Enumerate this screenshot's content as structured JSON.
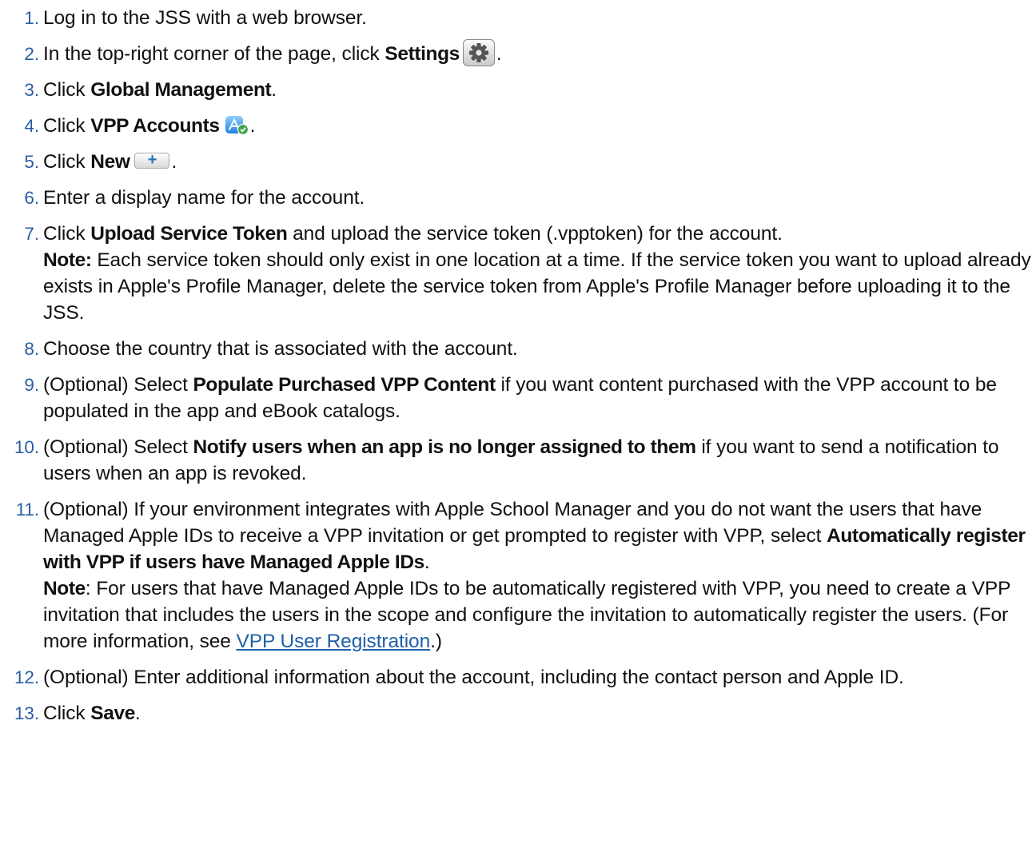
{
  "steps": [
    {
      "num": "1.",
      "parts": [
        {
          "t": "Log in to the JSS with a web browser."
        }
      ]
    },
    {
      "num": "2.",
      "parts": [
        {
          "t": "In the top-right corner of the page, click "
        },
        {
          "b": "Settings"
        },
        {
          "icon": "gear-icon"
        },
        {
          "t": "."
        }
      ]
    },
    {
      "num": "3.",
      "parts": [
        {
          "t": "Click "
        },
        {
          "b": "Global Management"
        },
        {
          "t": "."
        }
      ]
    },
    {
      "num": "4.",
      "parts": [
        {
          "t": "Click "
        },
        {
          "b": "VPP Accounts"
        },
        {
          "icon": "vpp-accounts-icon"
        },
        {
          "t": "."
        }
      ]
    },
    {
      "num": "5.",
      "parts": [
        {
          "t": "Click "
        },
        {
          "b": "New"
        },
        {
          "icon": "plus-icon"
        },
        {
          "t": "."
        }
      ]
    },
    {
      "num": "6.",
      "parts": [
        {
          "t": "Enter a display name for the account."
        }
      ]
    },
    {
      "num": "7.",
      "parts": [
        {
          "t": "Click "
        },
        {
          "b": "Upload Service Token"
        },
        {
          "t": " and upload the service token (.vpptoken) for the account."
        },
        {
          "br": true
        },
        {
          "b": "Note:"
        },
        {
          "t": " Each service token should only exist in one location at a time. If the service token you want to upload already exists in Apple's Profile Manager, delete the service token from Apple's Profile Manager before uploading it to the JSS."
        }
      ]
    },
    {
      "num": "8.",
      "parts": [
        {
          "t": "Choose the country that is associated with the account."
        }
      ]
    },
    {
      "num": "9.",
      "parts": [
        {
          "t": "(Optional) Select "
        },
        {
          "b": "Populate Purchased VPP Content"
        },
        {
          "t": " if you want content purchased with the VPP account to be populated in the app and eBook catalogs."
        }
      ]
    },
    {
      "num": "10.",
      "parts": [
        {
          "t": "(Optional) Select "
        },
        {
          "b": "Notify users when an app is no longer assigned to them"
        },
        {
          "t": " if you want to send a notification to users when an app is revoked."
        }
      ]
    },
    {
      "num": "11.",
      "parts": [
        {
          "t": "(Optional) If your environment integrates with Apple School Manager and you do not want the users that have Managed Apple IDs to receive a VPP invitation or get prompted to register with VPP, select "
        },
        {
          "b": "Automatically register with VPP if users have Managed Apple IDs"
        },
        {
          "t": "."
        },
        {
          "br": true
        },
        {
          "b": "Note"
        },
        {
          "t": ": For users that have Managed Apple IDs to be automatically registered with VPP, you need to create a VPP invitation that includes the users in the scope and configure the invitation to automatically register the users. (For more information, see "
        },
        {
          "link": "VPP User Registration"
        },
        {
          "t": ".)"
        }
      ]
    },
    {
      "num": "12.",
      "parts": [
        {
          "t": "(Optional) Enter additional information about the account, including the contact person and Apple ID."
        }
      ]
    },
    {
      "num": "13.",
      "parts": [
        {
          "t": "Click "
        },
        {
          "b": "Save"
        },
        {
          "t": "."
        }
      ]
    }
  ],
  "colors": {
    "step_number": "#2a5ea3",
    "link": "#1f5fa8",
    "plus": "#2c6fc0"
  }
}
